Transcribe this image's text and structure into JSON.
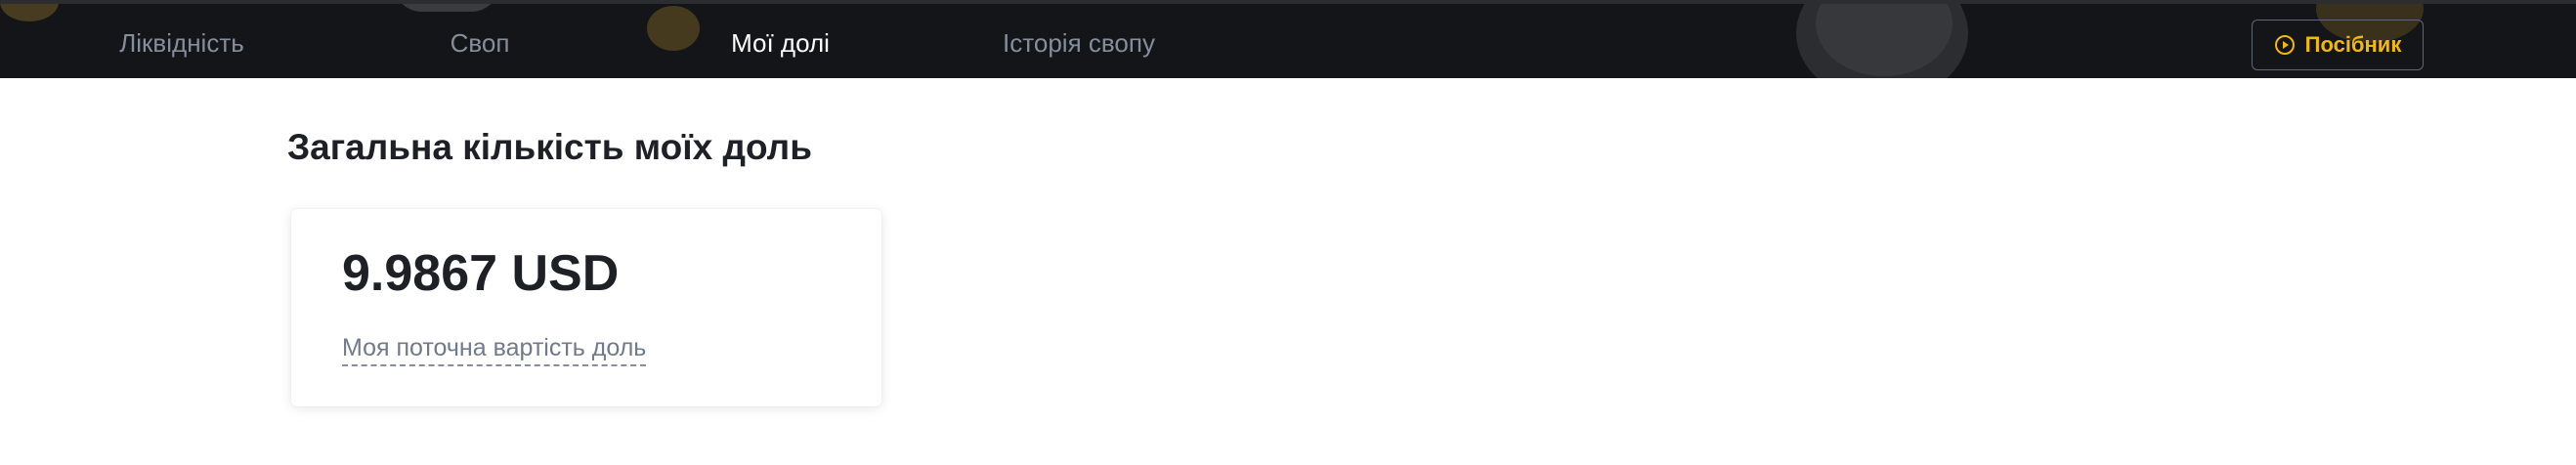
{
  "nav": {
    "tabs": [
      {
        "label": "Ліквідність",
        "active": false
      },
      {
        "label": "Своп",
        "active": false
      },
      {
        "label": "Мої долі",
        "active": true
      },
      {
        "label": "Історія свопу",
        "active": false
      }
    ],
    "guide_button": {
      "label": "Посібник",
      "icon": "play-circle-icon"
    }
  },
  "main": {
    "title": "Загальна кількість моїх доль",
    "card": {
      "value": "9.9867 USD",
      "caption": "Моя поточна вартість доль"
    }
  },
  "colors": {
    "accent": "#f0b90b",
    "topbar_bg": "#141518",
    "text_primary": "#1e2026",
    "text_secondary": "#707a8a",
    "tab_inactive": "#848e9c"
  }
}
